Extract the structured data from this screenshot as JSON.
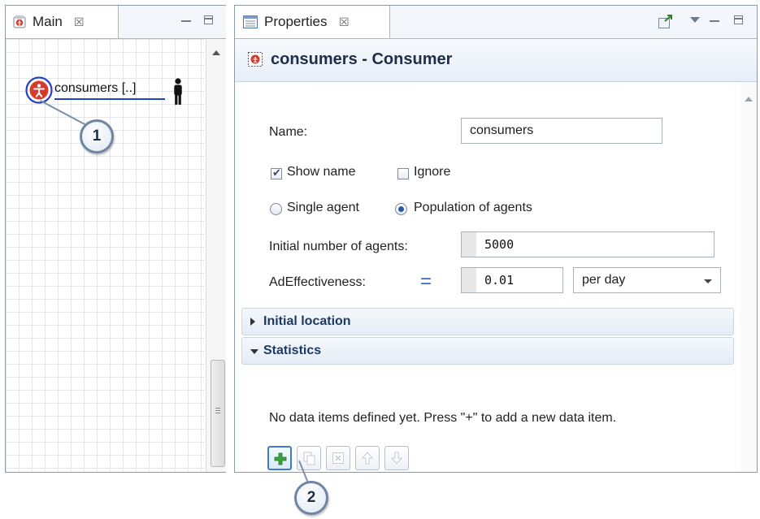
{
  "main_view": {
    "tab_label": "Main",
    "close_glyph": "☒",
    "agent_label": "consumers [..]"
  },
  "properties_view": {
    "tab_label": "Properties",
    "close_glyph": "☒",
    "title": "consumers - Consumer",
    "name_label": "Name:",
    "name_value": "consumers",
    "show_name_label": "Show name",
    "show_name_checked": true,
    "ignore_label": "Ignore",
    "ignore_checked": false,
    "single_agent_label": "Single agent",
    "population_label": "Population of agents",
    "selected_mode": "Population of agents",
    "initial_number_label": "Initial number of agents:",
    "initial_number_value": "5000",
    "adeffectiveness_label": "AdEffectiveness:",
    "equals_sign": "=",
    "adeffectiveness_value": "0.01",
    "unit_value": "per day",
    "section_initial_location": "Initial location",
    "section_statistics": "Statistics",
    "statistics_message": "No data items defined yet. Press \"+\" to add a new data item."
  },
  "callouts": [
    "1",
    "2"
  ],
  "icons": {
    "agent": "agent-person-icon",
    "person": "person-silhouette-icon",
    "add": "plus-icon",
    "copy": "copy-icon",
    "delete": "delete-icon",
    "up": "arrow-up-icon",
    "down": "arrow-down-icon"
  },
  "colors": {
    "accent": "#3d7bd0",
    "agent_red": "#d63a2c",
    "add_green": "#3aa641",
    "section_text": "#1d3a63"
  }
}
